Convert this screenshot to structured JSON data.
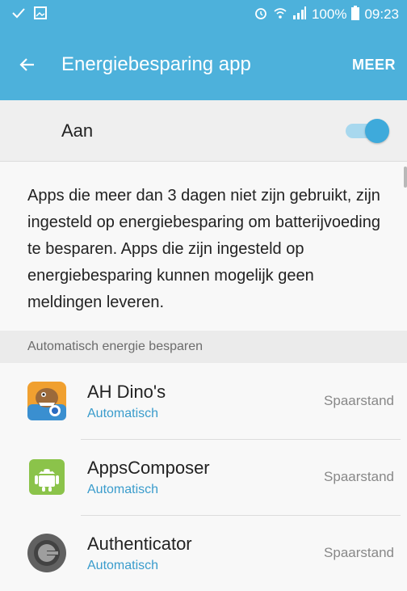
{
  "status_bar": {
    "battery_percent": "100%",
    "time": "09:23",
    "icons": [
      "check-icon",
      "image-icon",
      "alarm-icon",
      "wifi-icon",
      "signal-icon",
      "battery-icon"
    ]
  },
  "app_bar": {
    "title": "Energiebesparing app",
    "more_label": "MEER",
    "back_icon": "back-arrow-icon"
  },
  "master_switch": {
    "label": "Aan",
    "on": true
  },
  "description": "Apps die meer dan 3 dagen niet zijn gebruikt, zijn ingesteld op energiebesparing om batterijvoeding te besparen. Apps die zijn ingesteld op energiebesparing kunnen mogelijk geen meldingen leveren.",
  "section_header": "Automatisch energie besparen",
  "apps": [
    {
      "name": "AH Dino's",
      "status": "Automatisch",
      "mode": "Spaarstand",
      "icon": "ah-dinos-app-icon"
    },
    {
      "name": "AppsComposer",
      "status": "Automatisch",
      "mode": "Spaarstand",
      "icon": "android-app-icon"
    },
    {
      "name": "Authenticator",
      "status": "Automatisch",
      "mode": "Spaarstand",
      "icon": "authenticator-app-icon"
    }
  ],
  "colors": {
    "accent": "#4db1db",
    "toggle_on": "#3eaadb",
    "link": "#3a9ccc"
  }
}
